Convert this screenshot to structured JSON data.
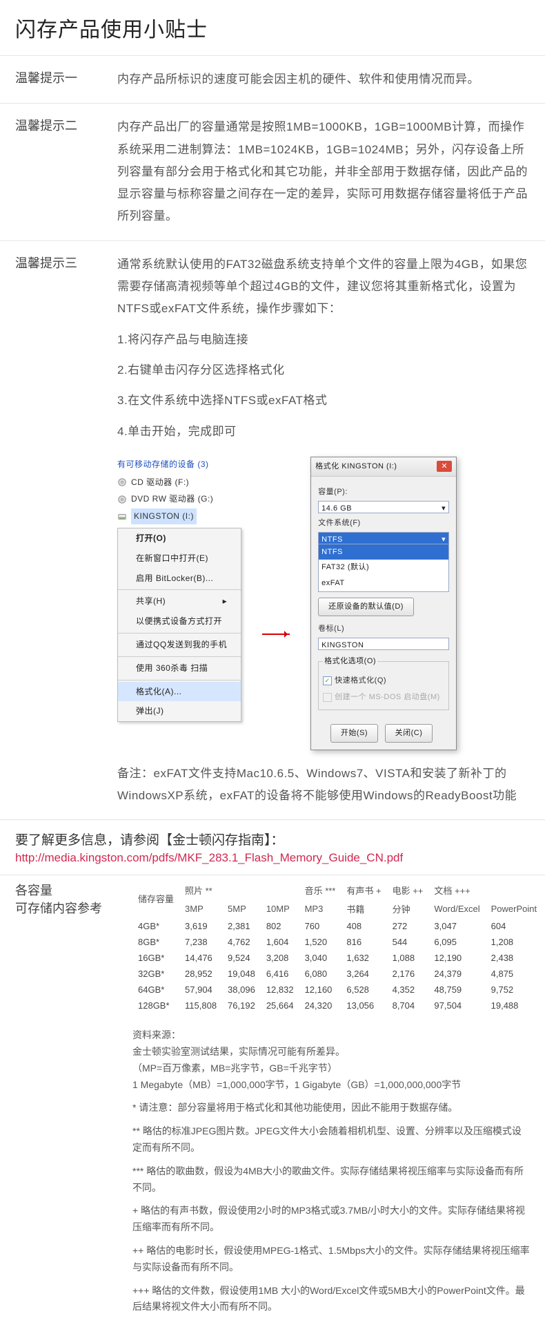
{
  "page": {
    "title": "闪存产品使用小贴士"
  },
  "tips": {
    "t1": {
      "label": "温馨提示一",
      "text": "内存产品所标识的速度可能会因主机的硬件、软件和使用情况而异。"
    },
    "t2": {
      "label": "温馨提示二",
      "text": "内存产品出厂的容量通常是按照1MB=1000KB，1GB=1000MB计算，而操作系统采用二进制算法：1MB=1024KB，1GB=1024MB；另外，闪存设备上所列容量有部分会用于格式化和其它功能，并非全部用于数据存储，因此产品的显示容量与标称容量之间存在一定的差异，实际可用数据存储容量将低于产品所列容量。"
    },
    "t3": {
      "label": "温馨提示三",
      "intro": "通常系统默认使用的FAT32磁盘系统支持单个文件的容量上限为4GB，如果您需要存储高清视频等单个超过4GB的文件，建议您将其重新格式化，设置为NTFS或exFAT文件系统，操作步骤如下：",
      "steps": [
        "1.将闪存产品与电脑连接",
        "2.右键单击闪存分区选择格式化",
        "3.在文件系统中选择NTFS或exFAT格式",
        "4.单击开始，完成即可"
      ],
      "remark": "备注：exFAT文件支持Mac10.6.5、Windows7、VISTA和安装了新补丁的WindowsXP系统，exFAT的设备将不能够使用Windows的ReadyBoost功能"
    }
  },
  "devices_panel": {
    "heading": "有可移动存储的设备 (3)",
    "items": [
      "CD 驱动器 (F:)",
      "DVD RW 驱动器 (G:)",
      "KINGSTON (I:)"
    ]
  },
  "context_menu": {
    "items": [
      "打开(O)",
      "在新窗口中打开(E)",
      "启用 BitLocker(B)...",
      "共享(H)",
      "以便携式设备方式打开",
      "通过QQ发送到我的手机",
      "使用 360杀毒 扫描",
      "格式化(A)...",
      "弹出(J)"
    ]
  },
  "format_dialog": {
    "title": "格式化 KINGSTON (I:)",
    "capacity_label": "容量(P):",
    "capacity_value": "14.6 GB",
    "fs_label": "文件系统(F)",
    "fs_selected": "NTFS",
    "fs_options": [
      "NTFS",
      "FAT32 (默认)",
      "exFAT"
    ],
    "restore_btn": "还原设备的默认值(D)",
    "vol_label": "卷标(L)",
    "vol_value": "KINGSTON",
    "opts_legend": "格式化选项(O)",
    "quick": "快速格式化(Q)",
    "msdos": "创建一个 MS-DOS 启动盘(M)",
    "start": "开始(S)",
    "close": "关闭(C)"
  },
  "more": {
    "text": "要了解更多信息，请参阅【金士顿闪存指南】：",
    "url": "http://media.kingston.com/pdfs/MKF_283.1_Flash_Memory_Guide_CN.pdf"
  },
  "capacity": {
    "title": "各容量\n可存储内容参考",
    "col_storage": "储存容量",
    "groups": [
      "照片 **",
      "音乐 ***",
      "有声书 +",
      "电影 ++",
      "文档 +++"
    ],
    "sub_headers": [
      "3MP",
      "5MP",
      "10MP",
      "MP3",
      "书籍",
      "分钟",
      "Word/Excel",
      "PowerPoint"
    ],
    "rows": [
      {
        "cap": "4GB*",
        "v": [
          "3,619",
          "2,381",
          "802",
          "760",
          "408",
          "272",
          "3,047",
          "604"
        ]
      },
      {
        "cap": "8GB*",
        "v": [
          "7,238",
          "4,762",
          "1,604",
          "1,520",
          "816",
          "544",
          "6,095",
          "1,208"
        ]
      },
      {
        "cap": "16GB*",
        "v": [
          "14,476",
          "9,524",
          "3,208",
          "3,040",
          "1,632",
          "1,088",
          "12,190",
          "2,438"
        ]
      },
      {
        "cap": "32GB*",
        "v": [
          "28,952",
          "19,048",
          "6,416",
          "6,080",
          "3,264",
          "2,176",
          "24,379",
          "4,875"
        ]
      },
      {
        "cap": "64GB*",
        "v": [
          "57,904",
          "38,096",
          "12,832",
          "12,160",
          "6,528",
          "4,352",
          "48,759",
          "9,752"
        ]
      },
      {
        "cap": "128GB*",
        "v": [
          "115,808",
          "76,192",
          "25,664",
          "24,320",
          "13,056",
          "8,704",
          "97,504",
          "19,488"
        ]
      }
    ]
  },
  "footnotes": {
    "src1": "资料来源：",
    "src2": "金士顿实验室测试结果，实际情况可能有所差异。",
    "src3": "（MP=百万像素，MB=兆字节，GB=千兆字节）",
    "src4": "1 Megabyte（MB）=1,000,000字节，1 Gigabyte（GB）=1,000,000,000字节",
    "n1": "* 请注意：部分容量将用于格式化和其他功能使用，因此不能用于数据存储。",
    "n2": "** 略估的标准JPEG图片数。JPEG文件大小会随着相机机型、设置、分辨率以及压缩模式设定而有所不同。",
    "n3": "*** 略估的歌曲数，假设为4MB大小的歌曲文件。实际存储结果将视压缩率与实际设备而有所不同。",
    "n4": "+ 略估的有声书数，假设使用2小时的MP3格式或3.7MB/小时大小的文件。实际存储结果将视压缩率而有所不同。",
    "n5": "++ 略估的电影时长，假设使用MPEG-1格式、1.5Mbps大小的文件。实际存储结果将视压缩率与实际设备而有所不同。",
    "n6": "+++ 略估的文件数，假设使用1MB 大小的Word/Excel文件或5MB大小的PowerPoint文件。最后结果将视文件大小而有所不同。"
  }
}
